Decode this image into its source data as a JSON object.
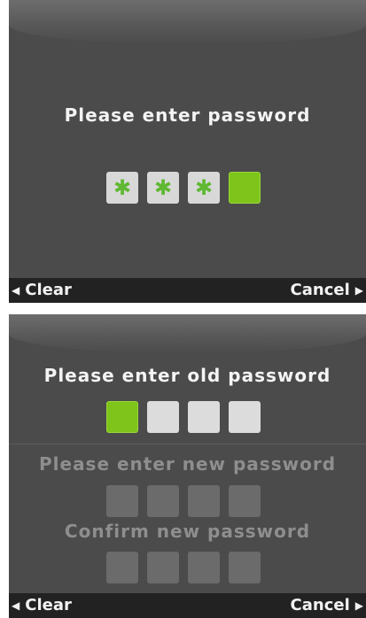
{
  "screen1": {
    "title": "Please enter password",
    "pin_boxes": [
      {
        "state": "filled",
        "char": "✱"
      },
      {
        "state": "filled",
        "char": "✱"
      },
      {
        "state": "filled",
        "char": "✱"
      },
      {
        "state": "active",
        "char": ""
      }
    ],
    "softkeys": {
      "left": "Clear",
      "right": "Cancel"
    }
  },
  "screen2": {
    "old_title": "Please enter old password",
    "new_title": "Please enter new password",
    "confirm_title": "Confirm new password",
    "old_boxes": [
      "active",
      "empty",
      "empty",
      "empty"
    ],
    "new_boxes": [
      "off",
      "off",
      "off",
      "off"
    ],
    "confirm_boxes": [
      "off",
      "off",
      "off",
      "off"
    ],
    "softkeys": {
      "left": "Clear",
      "right": "Cancel"
    }
  },
  "colors": {
    "screen_bg": "#4b4b4b",
    "active_green": "#7ec41a",
    "asterisk_green": "#5fb832",
    "softbar_bg": "#222222"
  }
}
